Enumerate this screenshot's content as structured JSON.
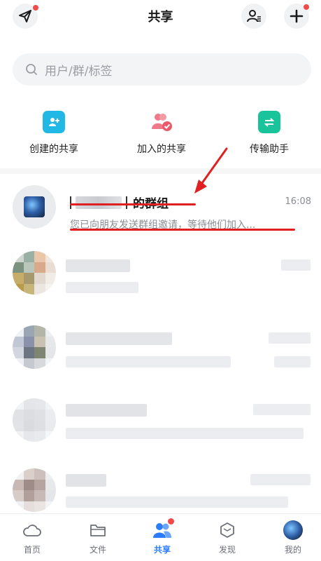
{
  "header": {
    "title": "共享",
    "left_icon": "paper-plane-icon",
    "right_icons": [
      "manage-user-icon",
      "plus-icon"
    ],
    "badge_color": "#f04a4a"
  },
  "search": {
    "placeholder": "用户/群/标签"
  },
  "shortcuts": [
    {
      "label": "创建的共享",
      "icon": "create-share-icon",
      "color": "#22b8e6"
    },
    {
      "label": "加入的共享",
      "icon": "joined-share-icon",
      "color": "#f07a8a"
    },
    {
      "label": "传输助手",
      "icon": "transfer-folder-icon",
      "color": "#19c49a"
    }
  ],
  "group": {
    "name_suffix": "的群组",
    "time": "16:08",
    "subtitle": "您已向朋友发送群组邀请，等待他们加入..."
  },
  "annotation": {
    "color": "#e02020"
  },
  "bottom_nav": [
    {
      "label": "首页",
      "icon": "cloud-icon",
      "active": false
    },
    {
      "label": "文件",
      "icon": "folder-icon",
      "active": false
    },
    {
      "label": "共享",
      "icon": "people-icon",
      "active": true
    },
    {
      "label": "发现",
      "icon": "cube-icon",
      "active": false
    },
    {
      "label": "我的",
      "icon": "profile-avatar",
      "active": false
    }
  ],
  "accent_color": "#2b7cff"
}
